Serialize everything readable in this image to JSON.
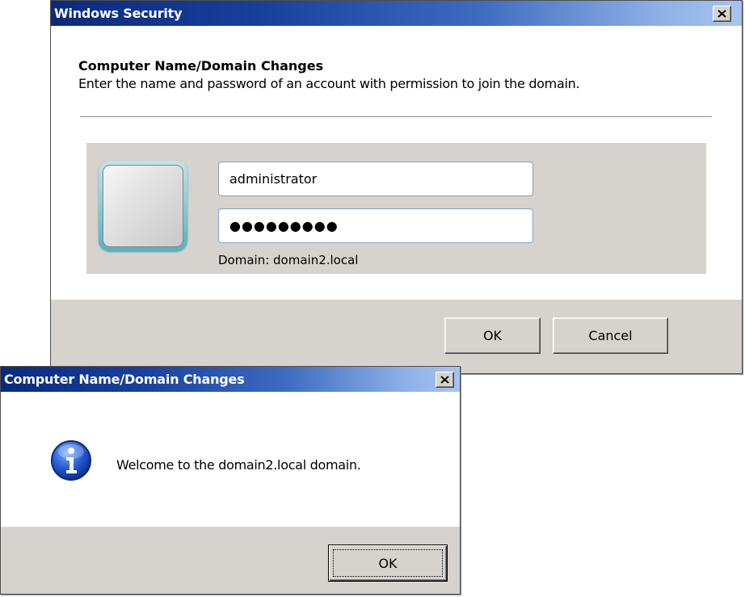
{
  "security_dialog": {
    "title": "Windows Security",
    "heading": "Computer Name/Domain Changes",
    "description": "Enter the name and password of an account with permission to join the domain.",
    "username_value": "administrator",
    "password_masked": "●●●●●●●●●",
    "domain_label": "Domain: domain2.local",
    "ok_label": "OK",
    "cancel_label": "Cancel",
    "close_glyph": "✕",
    "titlebar_color": "#17409b",
    "footer_color": "#d6d3ce"
  },
  "domain_dialog": {
    "title": "Computer Name/Domain Changes",
    "message": "Welcome to the domain2.local domain.",
    "icon": "info-icon",
    "ok_label": "OK",
    "close_glyph": "✕"
  }
}
